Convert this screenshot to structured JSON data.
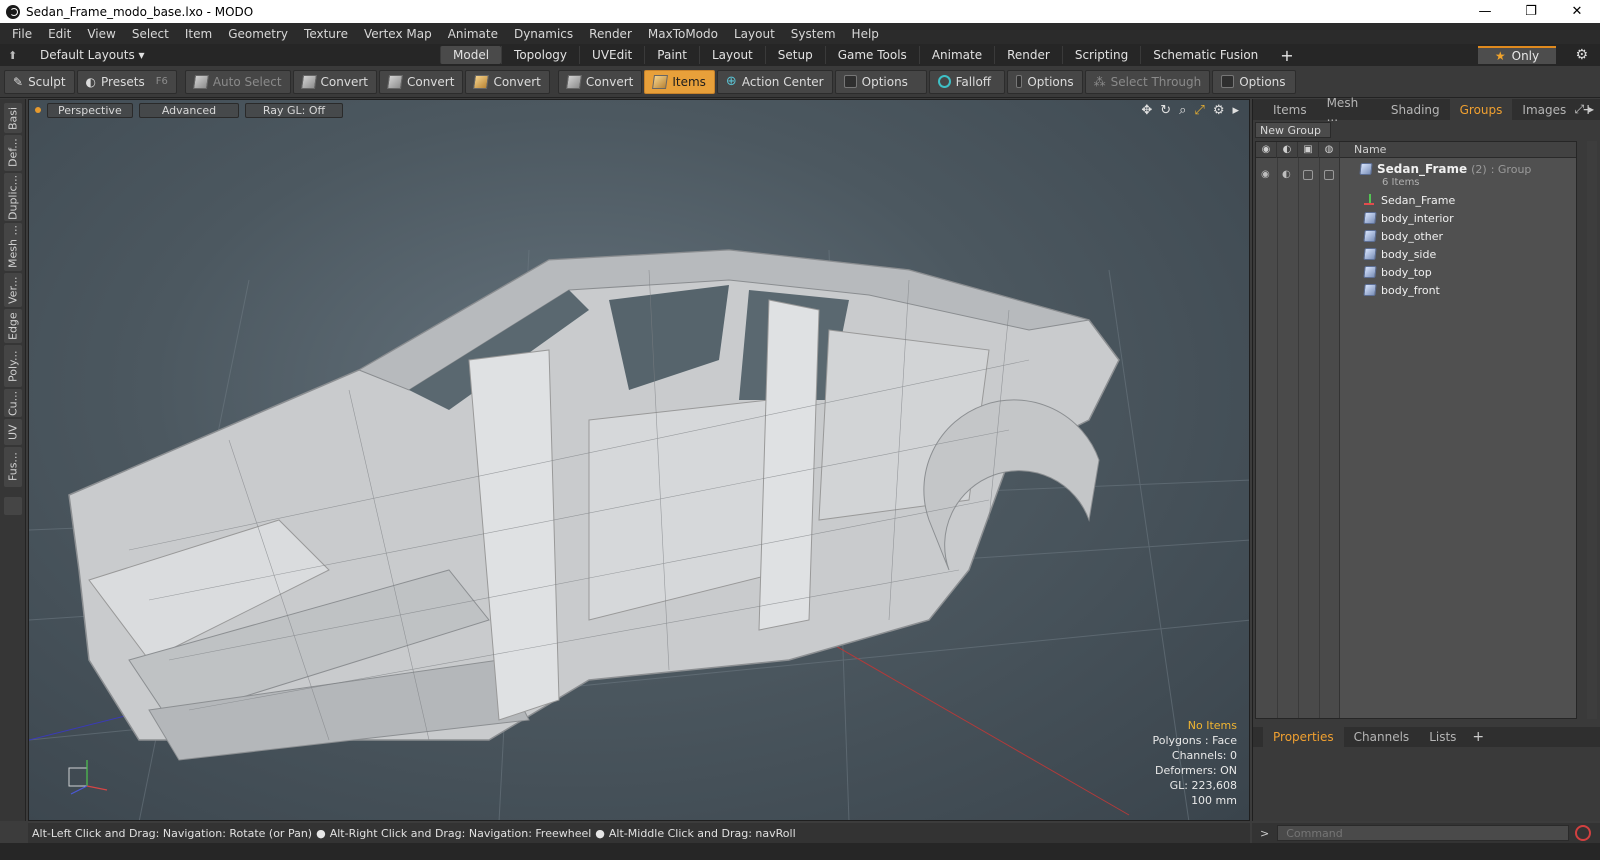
{
  "window": {
    "title": "Sedan_Frame_modo_base.lxo - MODO",
    "minimize": "—",
    "restore": "❐",
    "close": "✕"
  },
  "menu": [
    "File",
    "Edit",
    "View",
    "Select",
    "Item",
    "Geometry",
    "Texture",
    "Vertex Map",
    "Animate",
    "Dynamics",
    "Render",
    "MaxToModo",
    "Layout",
    "System",
    "Help"
  ],
  "layout_bar": {
    "dropdown": "Default Layouts ▾",
    "tabs": [
      "Model",
      "Topology",
      "UVEdit",
      "Paint",
      "Layout",
      "Setup",
      "Game Tools",
      "Animate",
      "Render",
      "Scripting",
      "Schematic Fusion"
    ],
    "active_tab": "Model",
    "plus": "+",
    "only_label": "Only"
  },
  "toolbar": {
    "sculpt": "Sculpt",
    "presets": "Presets",
    "presets_key": "F6",
    "auto_select": "Auto Select",
    "convert1": "Convert",
    "convert2": "Convert",
    "convert3": "Convert",
    "convert4": "Convert",
    "items": "Items",
    "action_center": "Action Center",
    "options1": "Options",
    "falloff": "Falloff",
    "options2": "Options",
    "select_through": "Select Through",
    "options3": "Options"
  },
  "left_tabs": [
    "Basi",
    "Def...",
    "Duplic...",
    "Mesh ...",
    "Ver...",
    "Edge",
    "Poly...",
    "Cu...",
    "UV",
    "Fus..."
  ],
  "viewport": {
    "view_mode": "Perspective",
    "shading": "Advanced",
    "raygl": "Ray GL: Off",
    "stats": {
      "items": "No Items",
      "polygons": "Polygons : Face",
      "channels": "Channels: 0",
      "deformers": "Deformers: ON",
      "gl": "GL: 223,608",
      "scale": "100 mm"
    }
  },
  "right_panel": {
    "tabs": [
      "Items",
      "Mesh ...",
      "Shading",
      "Groups",
      "Images"
    ],
    "active_tab": "Groups",
    "new_group": "New Group",
    "col_name": "Name",
    "group": {
      "name": "Sedan_Frame",
      "count": "(2)",
      "type": ": Group",
      "sub": "6 Items"
    },
    "children": [
      "Sedan_Frame",
      "body_interior",
      "body_other",
      "body_side",
      "body_top",
      "body_front"
    ],
    "bottom_tabs": [
      "Properties",
      "Channels",
      "Lists"
    ],
    "bottom_active": "Properties"
  },
  "status": {
    "hint1": "Alt-Left Click and Drag: Navigation: Rotate (or Pan)",
    "hint2": "Alt-Right Click and Drag: Navigation: Freewheel",
    "hint3": "Alt-Middle Click and Drag: navRoll"
  },
  "command": {
    "placeholder": "Command"
  }
}
